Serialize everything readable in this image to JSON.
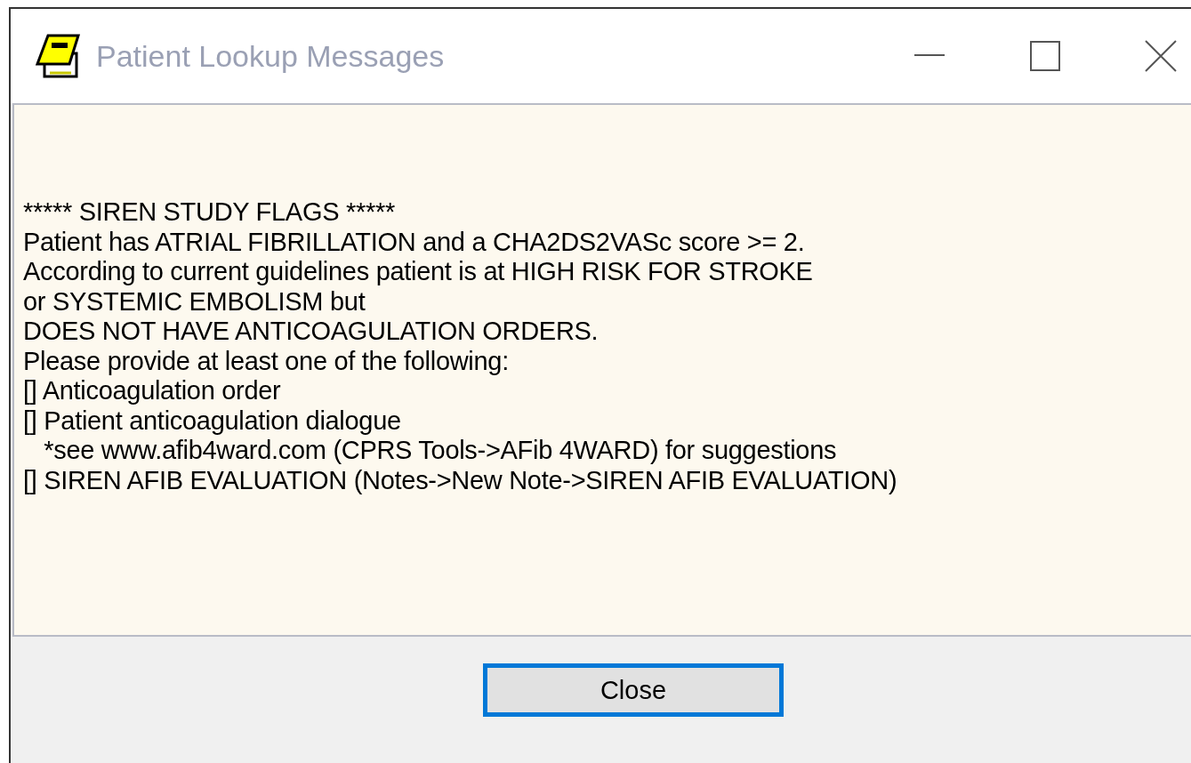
{
  "window": {
    "title": "Patient Lookup Messages",
    "active": false
  },
  "message": {
    "lines": [
      "***** SIREN STUDY FLAGS *****",
      "Patient has ATRIAL FIBRILLATION and a CHA2DS2VASc score >= 2.",
      "According to current guidelines patient is at HIGH RISK FOR STROKE",
      "or SYSTEMIC EMBOLISM but",
      "DOES NOT HAVE ANTICOAGULATION ORDERS.",
      "Please provide at least one of the following:",
      "[] Anticoagulation order",
      "[] Patient anticoagulation dialogue",
      "   *see www.afib4ward.com (CPRS Tools->AFib 4WARD) for suggestions",
      "[] SIREN AFIB EVALUATION (Notes->New Note->SIREN AFIB EVALUATION)"
    ]
  },
  "buttons": [
    {
      "label": "Close",
      "focused": true
    }
  ]
}
